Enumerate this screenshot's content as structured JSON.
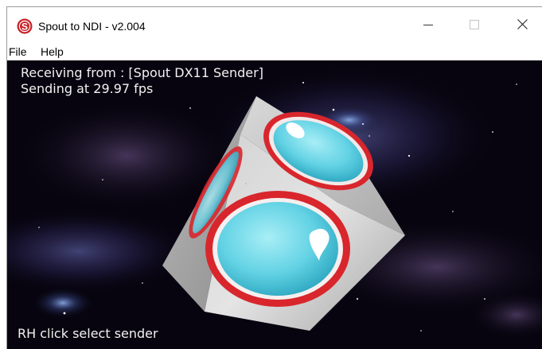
{
  "window": {
    "title": "Spout to NDI - v2.004",
    "app_icon_letter": "S",
    "controls": [
      "minimize",
      "maximize",
      "close"
    ]
  },
  "menu": {
    "items": [
      {
        "label": "File"
      },
      {
        "label": "Help"
      }
    ]
  },
  "viewport": {
    "receiving_text": "Receiving from : [Spout DX11 Sender]",
    "sending_text": "Sending at 29.97 fps",
    "hint_text": "RH click select sender"
  },
  "colors": {
    "background": "#07040f",
    "cube_face": "#d8d8d8",
    "ring_red": "#d8262c",
    "sphere_cyan": "#6fd6e6",
    "icon_red": "#c8232a"
  },
  "icons": {
    "app": "spout-logo-icon",
    "minimize": "minimize-icon",
    "maximize": "maximize-icon",
    "close": "close-icon"
  }
}
